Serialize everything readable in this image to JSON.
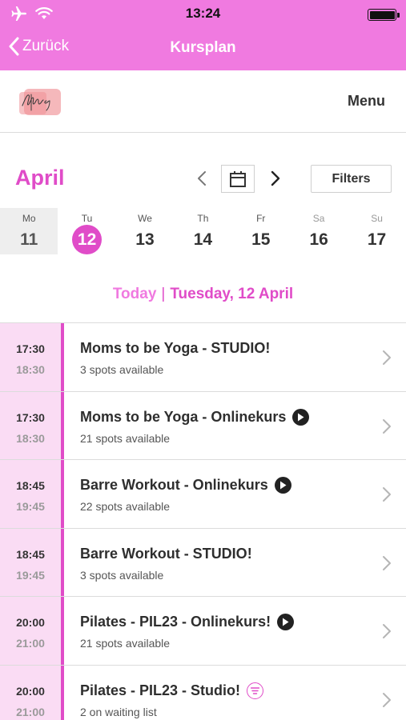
{
  "status_bar": {
    "time": "13:24"
  },
  "nav": {
    "back_label": "Zurück",
    "title": "Kursplan"
  },
  "header": {
    "menu_label": "Menu"
  },
  "calendar": {
    "month": "April",
    "filters_label": "Filters",
    "days": [
      {
        "name": "Mo",
        "date": "11"
      },
      {
        "name": "Tu",
        "date": "12"
      },
      {
        "name": "We",
        "date": "13"
      },
      {
        "name": "Th",
        "date": "14"
      },
      {
        "name": "Fr",
        "date": "15"
      },
      {
        "name": "Sa",
        "date": "16"
      },
      {
        "name": "Su",
        "date": "17"
      }
    ],
    "today_label": "Today",
    "selected_date_label": "Tuesday, 12 April"
  },
  "classes": [
    {
      "start": "17:30",
      "end": "18:30",
      "name": "Moms to be Yoga - STUDIO!",
      "availability": "3 spots available",
      "icon": ""
    },
    {
      "start": "17:30",
      "end": "18:30",
      "name": "Moms to be Yoga - Onlinekurs",
      "availability": "21 spots available",
      "icon": "play-icon"
    },
    {
      "start": "18:45",
      "end": "19:45",
      "name": "Barre Workout - Onlinekurs",
      "availability": "22 spots available",
      "icon": "play-icon"
    },
    {
      "start": "18:45",
      "end": "19:45",
      "name": "Barre Workout - STUDIO!",
      "availability": "3 spots available",
      "icon": ""
    },
    {
      "start": "20:00",
      "end": "21:00",
      "name": "Pilates - PIL23 - Onlinekurs!",
      "availability": "21 spots available",
      "icon": "play-icon"
    },
    {
      "start": "20:00",
      "end": "21:00",
      "name": "Pilates - PIL23 - Studio!",
      "availability": "2 on waiting list",
      "icon": "waiting-list-icon"
    }
  ],
  "colors": {
    "nav_bar": "#f07ae0",
    "accent": "#e04cc8",
    "time_column": "#fadcf4"
  }
}
